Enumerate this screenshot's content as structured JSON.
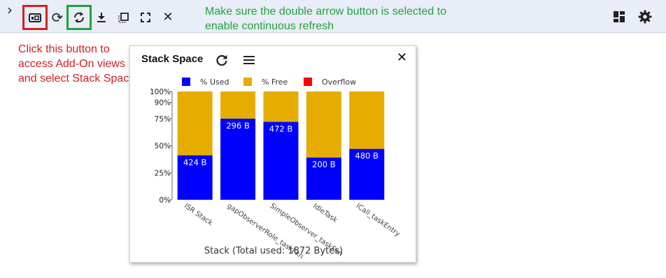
{
  "toolbar": {
    "expand_glyph": "›",
    "buttons": [
      {
        "name": "addon-views-button",
        "icon": "addon-views-icon"
      },
      {
        "name": "refresh-button",
        "icon": "refresh-icon",
        "glyph": "⟳"
      },
      {
        "name": "continuous-refresh-button",
        "icon": "double-arrow-refresh-icon"
      },
      {
        "name": "download-button",
        "icon": "download-icon",
        "glyph": "⭳"
      },
      {
        "name": "select-button",
        "icon": "select-icon"
      },
      {
        "name": "fullscreen-button",
        "icon": "fullscreen-icon"
      },
      {
        "name": "close-button",
        "icon": "close-icon",
        "glyph": "✕"
      }
    ],
    "right_icons": [
      "dashboard-icon",
      "gear-icon"
    ]
  },
  "annotations": {
    "green": "Make sure the double arrow button is selected to enable continuous refresh",
    "red": "Click this button to access Add-On views and select Stack Space"
  },
  "colors": {
    "highlight_red": "#d62020",
    "highlight_green": "#1fa33b",
    "used": "#0000ff",
    "free": "#e6ac00",
    "overflow": "#ff0000"
  },
  "panel": {
    "title": "Stack Space",
    "close_glyph": "✕",
    "icons": [
      "refresh-icon",
      "menu-icon"
    ]
  },
  "chart_data": {
    "type": "bar",
    "stacked": true,
    "categories": [
      "ISR Stack",
      "gapObserverRole_taskFxn",
      "SimpleObserver_taskFxn",
      "IdleTask",
      "ICall_taskEntry"
    ],
    "series": [
      {
        "name": "% Used",
        "values": [
          41,
          75,
          72,
          39,
          47
        ]
      },
      {
        "name": "% Free",
        "values": [
          59,
          25,
          28,
          61,
          53
        ]
      },
      {
        "name": "Overflow",
        "values": [
          0,
          0,
          0,
          0,
          0
        ]
      }
    ],
    "data_labels": [
      "424 B",
      "296 B",
      "472 B",
      "200 B",
      "480 B"
    ],
    "yticks": [
      "0%",
      "25%",
      "50%",
      "75%",
      "90%",
      "100%"
    ],
    "ytick_values": [
      0,
      25,
      50,
      75,
      90,
      100
    ],
    "ylim": [
      0,
      100
    ],
    "xlabel": "Stack (Total used: 1872 Bytes)",
    "legend_position": "top",
    "grid": false
  }
}
